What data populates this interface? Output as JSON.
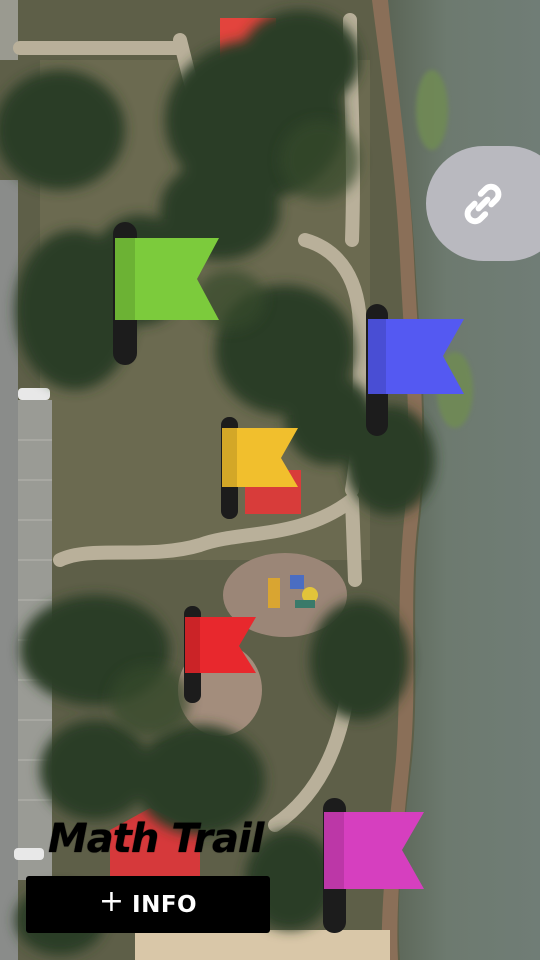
{
  "app": {
    "title": "Math Trail"
  },
  "info_button": {
    "plus_icon": "+",
    "label": "INFO"
  },
  "link_button": {
    "icon": "link-icon",
    "color": "#b9b9bf"
  },
  "map": {
    "type": "satellite",
    "features": [
      "lake",
      "park-paths",
      "playground",
      "pavilions",
      "parking-lot"
    ]
  },
  "flags": [
    {
      "id": "green",
      "color": "#7ccb3c"
    },
    {
      "id": "blue",
      "color": "#5459f2"
    },
    {
      "id": "yellow",
      "color": "#f1bf2d"
    },
    {
      "id": "red",
      "color": "#e8282d"
    },
    {
      "id": "magenta",
      "color": "#d63fbf"
    }
  ],
  "colors": {
    "flag_pole": "#1c1c1c",
    "button_bg": "#000000",
    "button_text": "#ffffff"
  }
}
